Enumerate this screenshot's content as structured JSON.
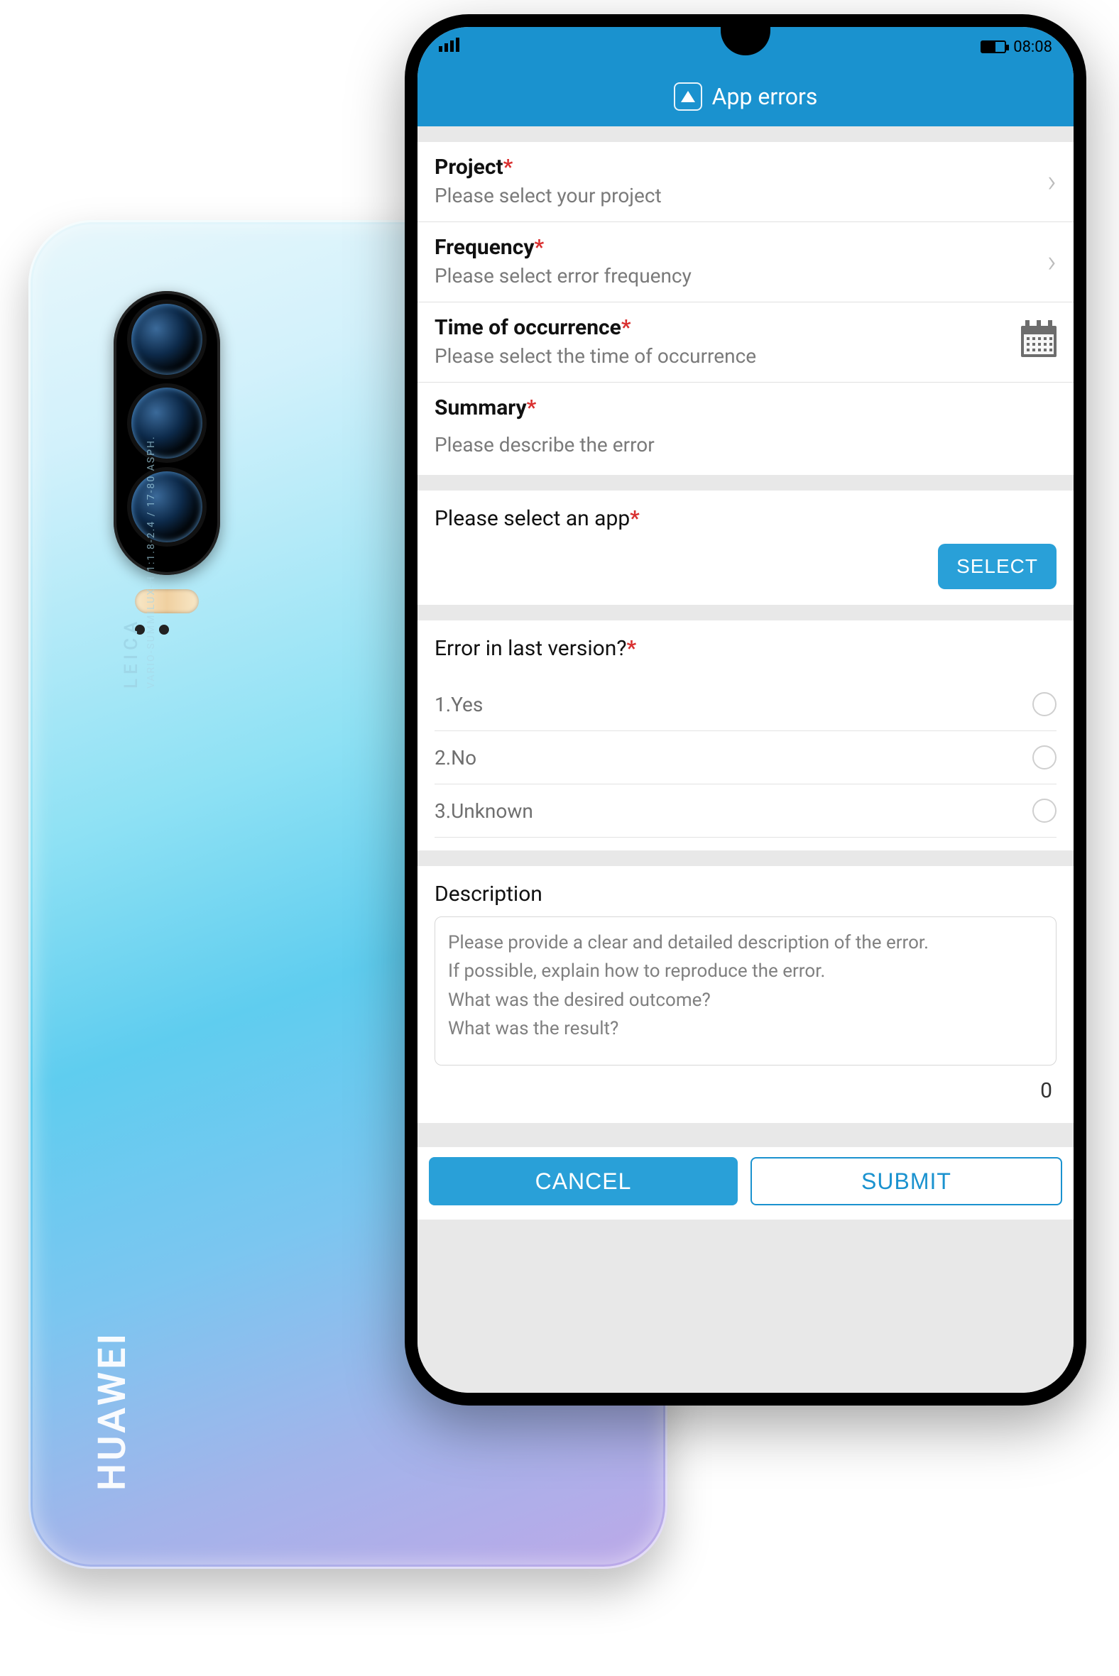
{
  "status": {
    "time": "08:08"
  },
  "header": {
    "title": "App errors"
  },
  "fields": {
    "project": {
      "label": "Project",
      "placeholder": "Please select your project"
    },
    "frequency": {
      "label": "Frequency",
      "placeholder": "Please select error frequency"
    },
    "time": {
      "label": "Time of occurrence",
      "placeholder": "Please select the time of occurrence"
    },
    "summary": {
      "label": "Summary",
      "placeholder": "Please describe the error"
    }
  },
  "select_app": {
    "label": "Please select an app",
    "button": "SELECT"
  },
  "last_version": {
    "label": "Error in last version?",
    "options": [
      "1.Yes",
      "2.No",
      "3.Unknown"
    ]
  },
  "description": {
    "label": "Description",
    "placeholder": "Please provide a clear and detailed description of the error.\nIf possible, explain how to reproduce the error.\nWhat was the desired outcome?\nWhat was the result?",
    "char_count": "0"
  },
  "footer": {
    "cancel": "CANCEL",
    "submit": "SUBMIT"
  },
  "back_phone": {
    "leica": "LEICA",
    "leica_sub": "VARIO-SUMMILUX-H 1:1.8-2.4 / 17-80 ASPH.",
    "brand": "HUAWEI"
  },
  "colors": {
    "primary": "#1a92cf",
    "primary_light": "#29a0d8",
    "required": "#d93030"
  }
}
